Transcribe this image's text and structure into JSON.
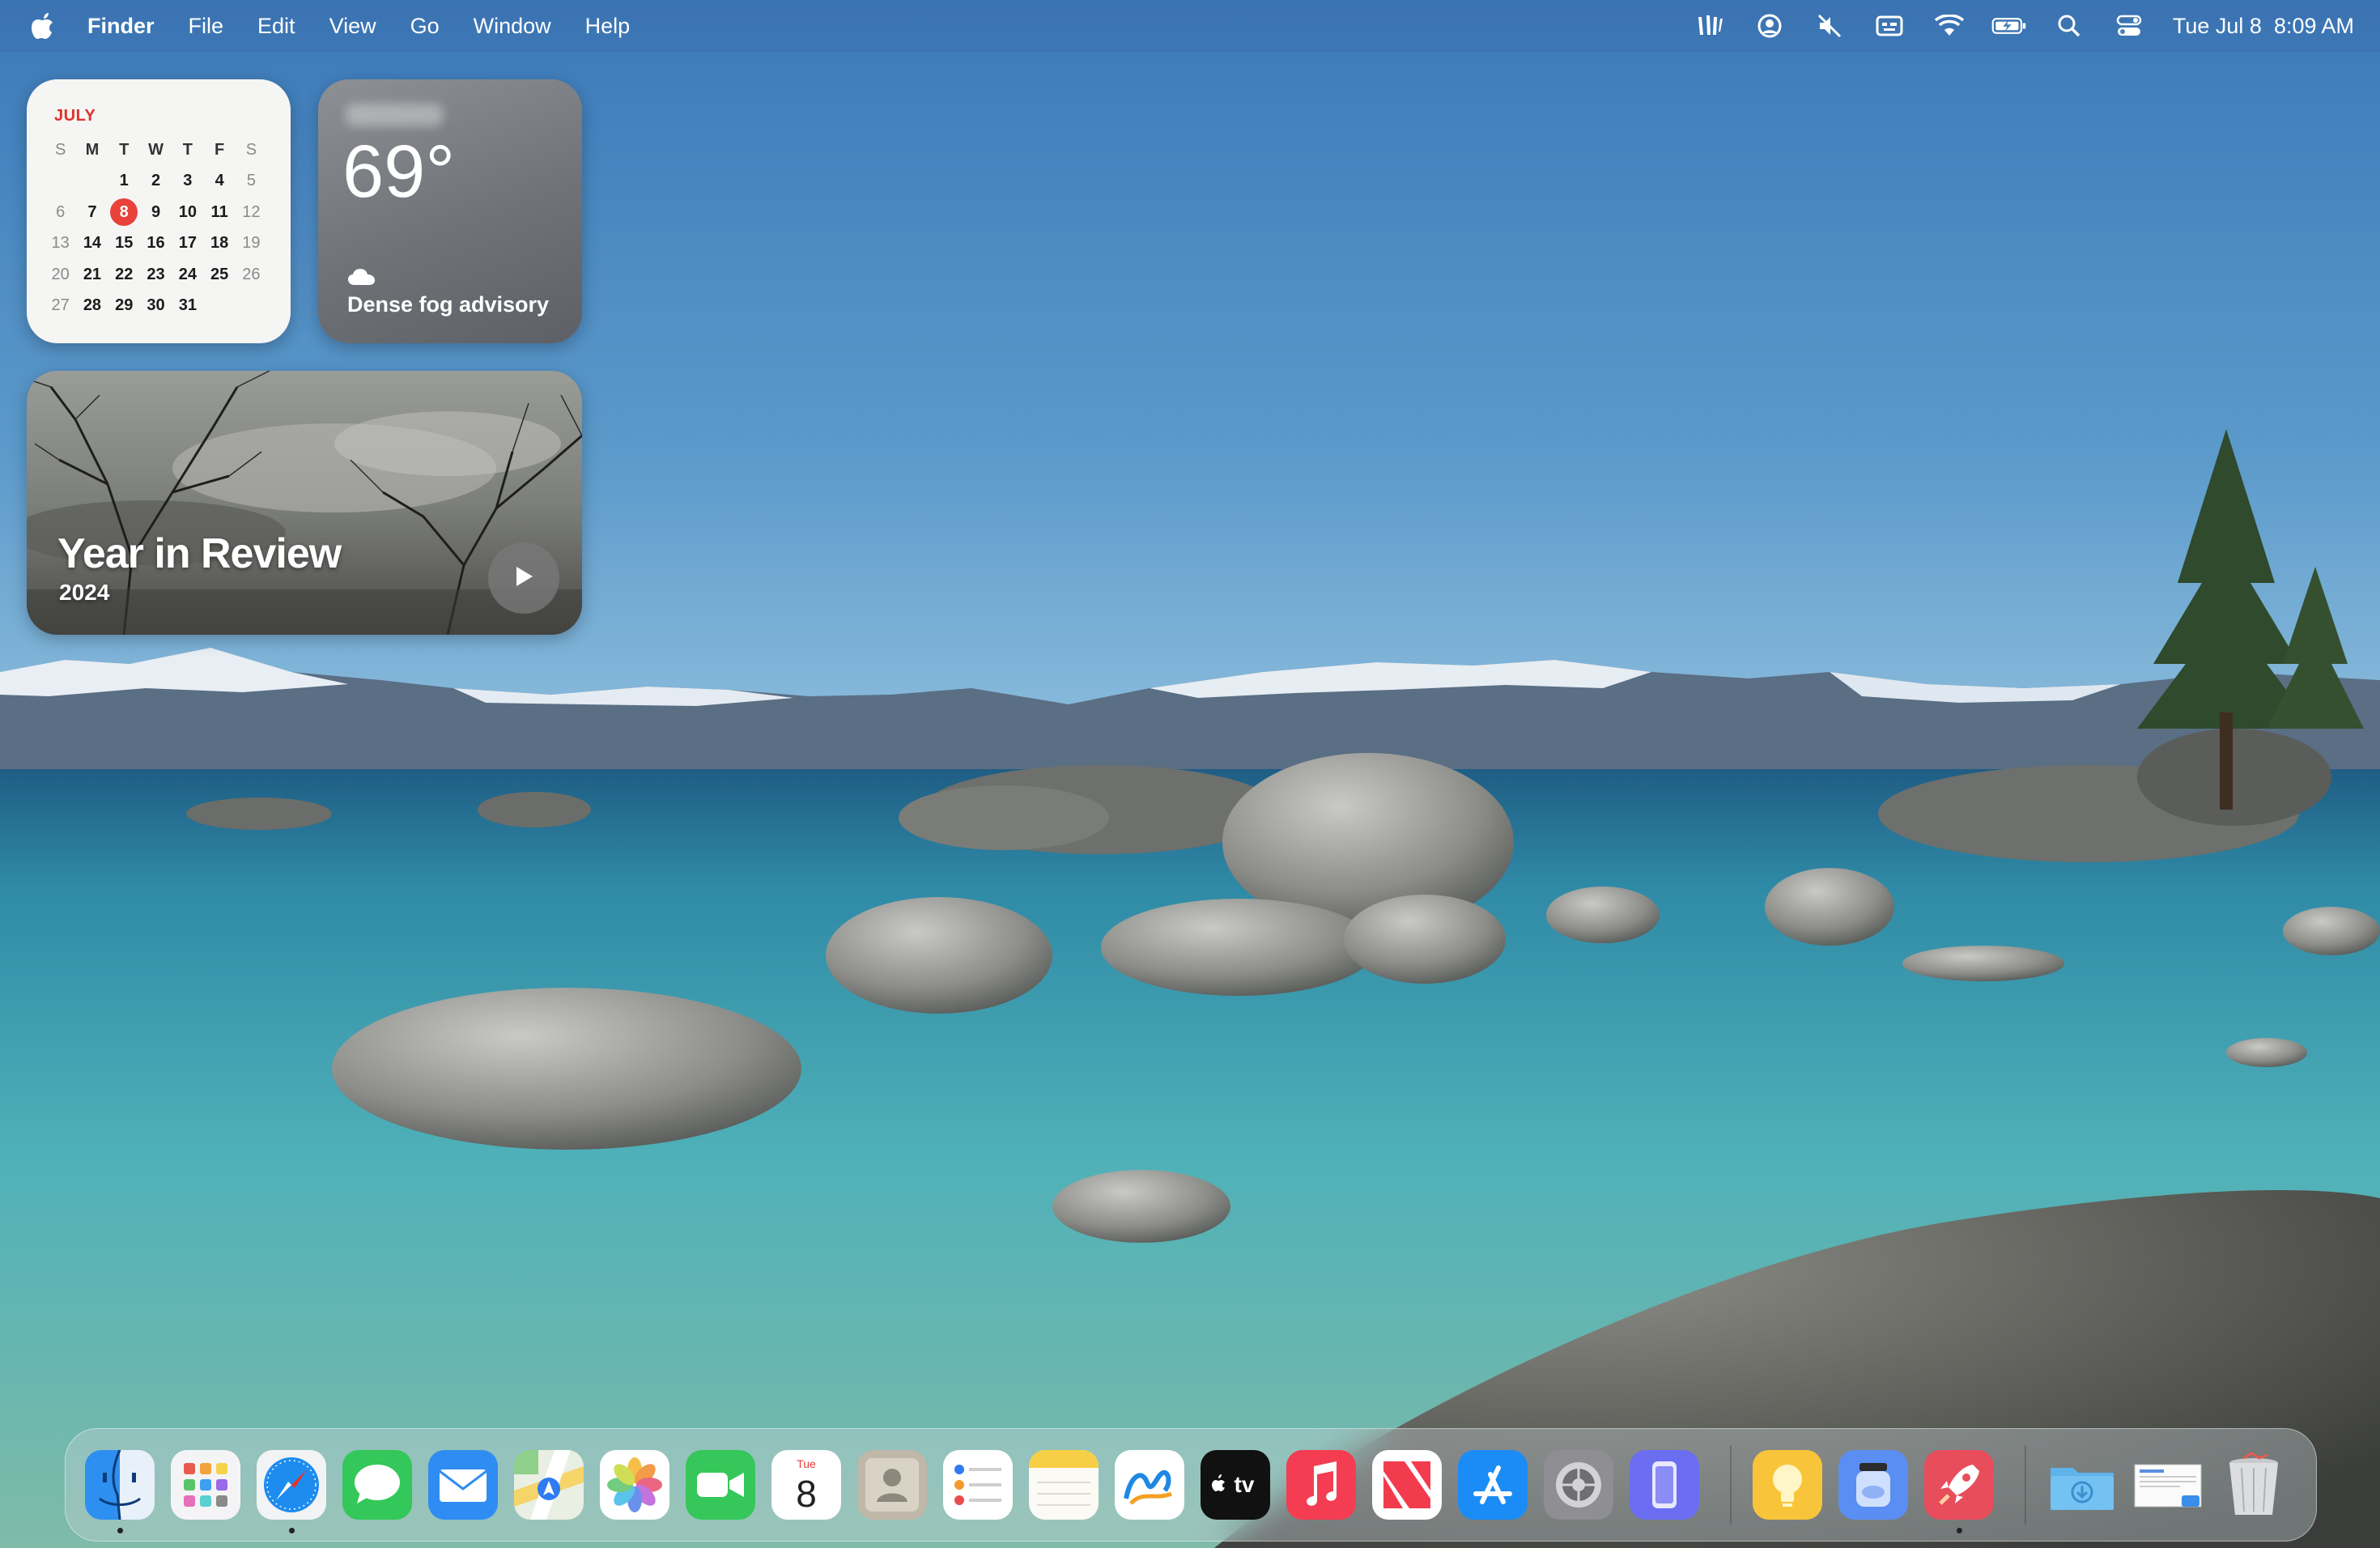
{
  "menubar": {
    "apple_icon": "apple-logo-icon",
    "app_name": "Finder",
    "items": [
      "File",
      "Edit",
      "View",
      "Go",
      "Window",
      "Help"
    ],
    "status_icons": [
      "audio-app-icon",
      "user-account-icon",
      "mute-speaker-icon",
      "input-source-icon",
      "wifi-icon",
      "battery-charging-icon",
      "spotlight-search-icon",
      "control-center-icon"
    ],
    "clock_date": "Tue Jul 8",
    "clock_time": "8:09 AM"
  },
  "calendar_widget": {
    "month": "JULY",
    "weekday_headers": [
      "S",
      "M",
      "T",
      "W",
      "T",
      "F",
      "S"
    ],
    "weeks": [
      [
        "",
        "",
        "1",
        "2",
        "3",
        "4",
        "5"
      ],
      [
        "6",
        "7",
        "8",
        "9",
        "10",
        "11",
        "12"
      ],
      [
        "13",
        "14",
        "15",
        "16",
        "17",
        "18",
        "19"
      ],
      [
        "20",
        "21",
        "22",
        "23",
        "24",
        "25",
        "26"
      ],
      [
        "27",
        "28",
        "29",
        "30",
        "31",
        "",
        ""
      ]
    ],
    "today": "8",
    "today_color": "#e8423a"
  },
  "weather_widget": {
    "temperature": "69°",
    "condition": "Dense fog advisory",
    "condition_icon": "cloud-icon"
  },
  "memories_widget": {
    "title": "Year in Review",
    "year": "2024",
    "play_icon": "play-icon"
  },
  "dock": {
    "apps": [
      {
        "name": "Finder",
        "icon": "finder-icon",
        "running": true
      },
      {
        "name": "Launchpad",
        "icon": "launchpad-icon",
        "running": false
      },
      {
        "name": "Safari",
        "icon": "safari-icon",
        "running": true
      },
      {
        "name": "Messages",
        "icon": "messages-icon",
        "running": false
      },
      {
        "name": "Mail",
        "icon": "mail-icon",
        "running": false
      },
      {
        "name": "Maps",
        "icon": "maps-icon",
        "running": false
      },
      {
        "name": "Photos",
        "icon": "photos-icon",
        "running": false
      },
      {
        "name": "FaceTime",
        "icon": "facetime-icon",
        "running": false
      },
      {
        "name": "Calendar",
        "icon": "calendar-icon",
        "running": false
      },
      {
        "name": "Contacts",
        "icon": "contacts-icon",
        "running": false
      },
      {
        "name": "Reminders",
        "icon": "reminders-icon",
        "running": false
      },
      {
        "name": "Notes",
        "icon": "notes-icon",
        "running": false
      },
      {
        "name": "Freeform",
        "icon": "freeform-icon",
        "running": false
      },
      {
        "name": "TV",
        "icon": "apple-tv-icon",
        "running": false
      },
      {
        "name": "Music",
        "icon": "music-icon",
        "running": false
      },
      {
        "name": "News",
        "icon": "news-icon",
        "running": false
      },
      {
        "name": "App Store",
        "icon": "app-store-icon",
        "running": false
      },
      {
        "name": "System Settings",
        "icon": "system-settings-icon",
        "running": false
      },
      {
        "name": "iPhone Mirroring",
        "icon": "iphone-mirroring-icon",
        "running": false
      },
      {
        "name": "Tips",
        "icon": "tips-lightbulb-icon",
        "running": false
      },
      {
        "name": "Jar App",
        "icon": "jar-app-icon",
        "running": false
      },
      {
        "name": "Rocket App",
        "icon": "rocket-app-icon",
        "running": true
      },
      {
        "name": "Downloads",
        "icon": "downloads-folder-icon",
        "running": false
      },
      {
        "name": "Screenshot",
        "icon": "screenshot-stack-icon",
        "running": false
      },
      {
        "name": "Trash",
        "icon": "trash-icon",
        "running": false
      }
    ],
    "calendar_icon_day": "Tue",
    "calendar_icon_date": "8",
    "tv_icon_label": "tv"
  }
}
